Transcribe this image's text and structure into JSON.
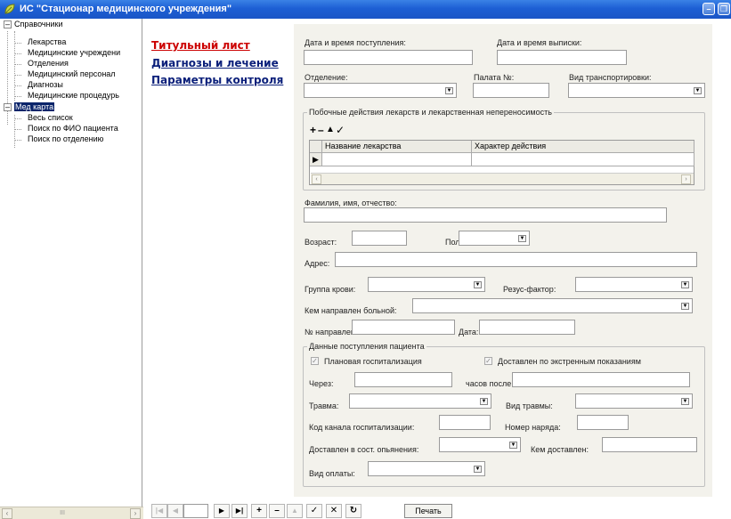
{
  "window": {
    "title": "ИС \"Стационар медицинского учреждения\"",
    "minimize_glyph": "–",
    "restore_glyph": "❐"
  },
  "tree": {
    "root1": {
      "label": "Справочники",
      "expander": "–"
    },
    "root1_items": [
      "Лекарства",
      "Медицинские учреждени",
      "Отделения",
      "Медицинский персонал",
      "Диагнозы",
      "Медицинские процедурь"
    ],
    "root2": {
      "label": "Мед карта",
      "expander": "–"
    },
    "root2_items": [
      "Весь список",
      "Поиск по ФИО пациента",
      "Поиск по отделению"
    ],
    "scroll": {
      "left": "‹",
      "right": "›",
      "thumb": "III"
    }
  },
  "links": {
    "title_sheet": "Титульный лист",
    "diagnoses": "Диагнозы и лечение",
    "params": "Параметры контроля",
    "active_color": "#cc0000",
    "link_color": "#0a1f7a"
  },
  "form": {
    "admit_datetime_label": "Дата и время поступления:",
    "discharge_datetime_label": "Дата и время выписки:",
    "department_label": "Отделение:",
    "ward_label": "Палата №:",
    "transport_label": "Вид транспортировки:",
    "side_effects_group": "Побочные действия лекарств и лекарственная непереносимость",
    "grid_buttons": [
      "+",
      "–",
      "▲",
      "✓"
    ],
    "grid_columns": [
      "Название лекарства",
      "Характер действия"
    ],
    "row_marker": "▶",
    "fio_label": "Фамилия, имя, отчество:",
    "age_label": "Возраст:",
    "sex_label": "Пол:",
    "address_label": "Адрес:",
    "blood_group_label": "Группа крови:",
    "rh_label": "Резус-фактор:",
    "referred_by_label": "Кем направлен больной:",
    "referral_no_label": "№ направления:",
    "date_label": "Дата:",
    "admission_group": "Данные поступления пациента",
    "planned_label": "Плановая госпитализация",
    "emergency_label": "Доставлен по экстренным показаниям",
    "check_glyph": "✓",
    "after_label": "Через:",
    "hours_after_label": "часов после",
    "trauma_label": "Травма:",
    "trauma_type_label": "Вид травмы:",
    "channel_code_label": "Код канала госпитализации:",
    "order_no_label": "Номер наряда:",
    "intox_label": "Доставлен в сост. опьянения:",
    "delivered_by_label": "Кем доставлен:",
    "payment_label": "Вид оплаты:",
    "dropdown_arrow": "▼"
  },
  "navigator": {
    "first": "|◀",
    "prior": "◀",
    "next": "▶",
    "last": "▶|",
    "insert": "+",
    "delete": "–",
    "edit": "▲",
    "post": "✓",
    "cancel": "✕",
    "refresh": "↻",
    "print_label": "Печать"
  }
}
